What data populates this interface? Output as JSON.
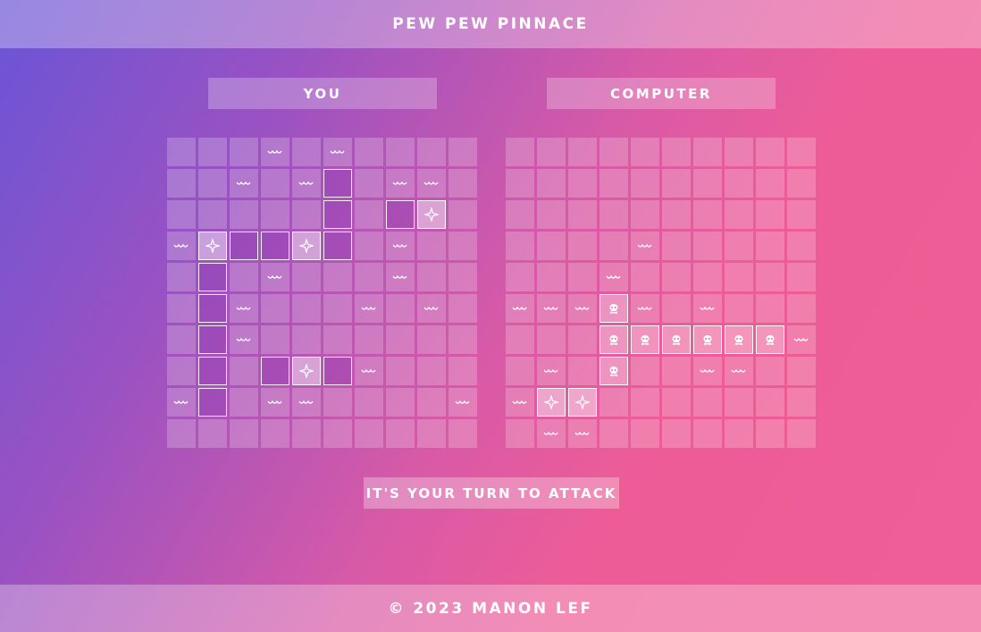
{
  "header": {
    "title": "PEW PEW PINNACE"
  },
  "boards": {
    "player": {
      "label": "YOU",
      "grid": [
        "...w.w....",
        "..w.wS.ww.",
        ".....S.SH.",
        "wHSSHS.w..",
        ".S.w...w..",
        ".Sw...w.w.",
        ".Sw.......",
        ".S.SHSw...",
        "wS.ww....w",
        ".........."
      ]
    },
    "computer": {
      "label": "COMPUTER",
      "grid": [
        "..........",
        "..........",
        "..........",
        "....w.....",
        "...w......",
        "wwwXw.w...",
        "...XXXXXXw",
        ".w.X..ww..",
        "wHH.......",
        ".ww......."
      ]
    }
  },
  "legend": {
    "w": "miss-wave-icon",
    "S": "ship-segment",
    "H": "hit-sparkle-icon",
    "X": "sunk-skull-icon"
  },
  "status": {
    "text": "IT'S YOUR TURN TO ATTACK"
  },
  "footer": {
    "copyright": "© 2023 MANON LEF"
  }
}
